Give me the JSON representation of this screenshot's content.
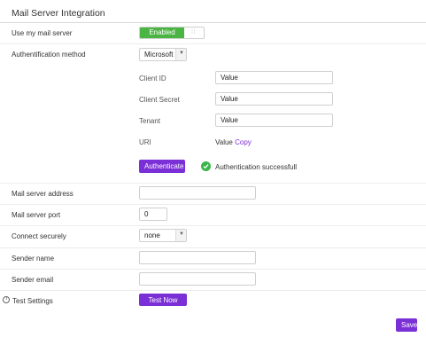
{
  "title": "Mail Server Integration",
  "use_mail_server": {
    "label": "Use my mail server",
    "toggle_state": "Enabled",
    "grip": "⁞⁞"
  },
  "auth_method": {
    "label": "Authentification method",
    "selected": "Microsoft"
  },
  "client_id": {
    "label": "Client ID",
    "value": "Value"
  },
  "client_secret": {
    "label": "Client Secret",
    "value": "Value"
  },
  "tenant": {
    "label": "Tenant",
    "value": "Value"
  },
  "uri": {
    "label": "URI",
    "value": "Value",
    "copy_label": "Copy"
  },
  "authenticate": {
    "button_label": "Authenticate",
    "status_text": "Authentication successfull"
  },
  "mail_server_address": {
    "label": "Mail server address",
    "value": ""
  },
  "mail_server_port": {
    "label": "Mail server port",
    "value": "0"
  },
  "connect_securely": {
    "label": "Connect securely",
    "selected": "none"
  },
  "sender_name": {
    "label": "Sender name",
    "value": ""
  },
  "sender_email": {
    "label": "Sender email",
    "value": ""
  },
  "test_settings": {
    "label": "Test Settings",
    "button_label": "Test Now",
    "info_glyph": "i"
  },
  "save_label": "Save",
  "colors": {
    "accent": "#7b2fd6",
    "success": "#4bb543"
  }
}
